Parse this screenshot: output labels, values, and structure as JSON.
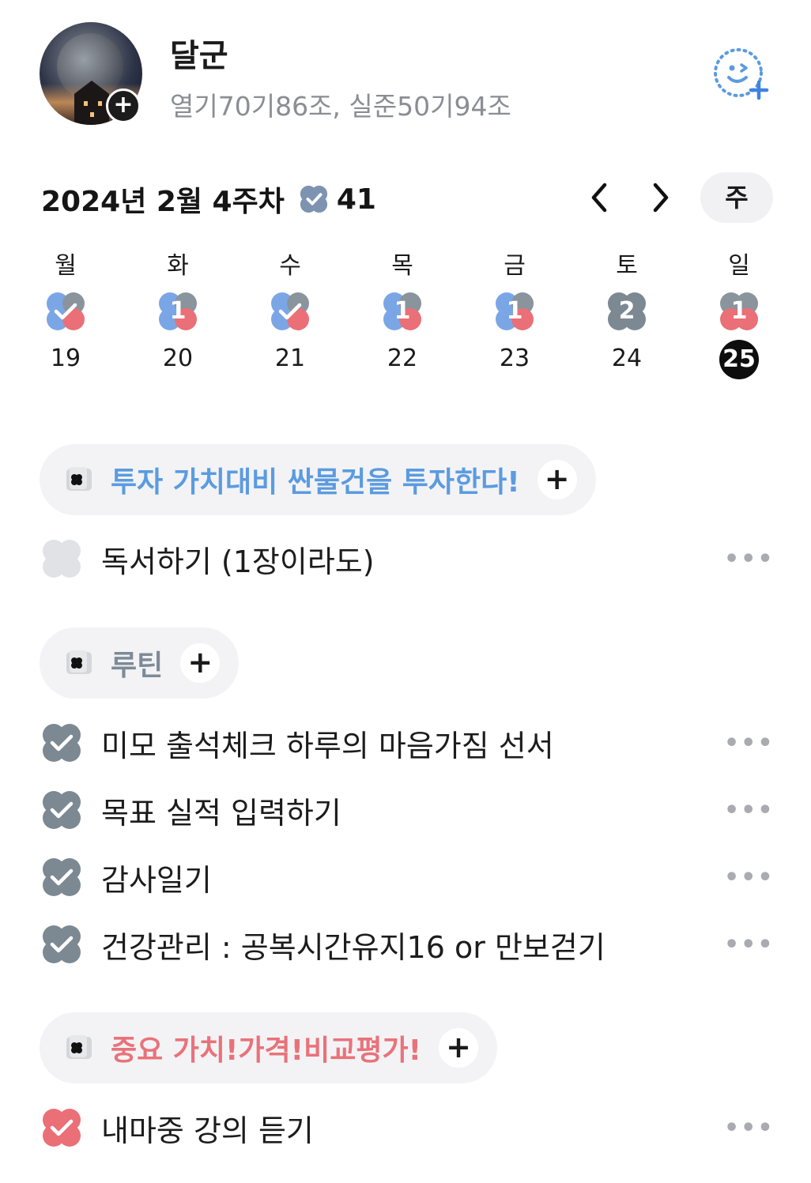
{
  "profile": {
    "name": "달군",
    "bio": "열기70기86조, 실준50기94조"
  },
  "week": {
    "title": "2024년 2월 4주차",
    "count": "41",
    "view_mode": "주",
    "days": [
      {
        "name": "월",
        "date": "19",
        "badge": "✓",
        "state": "done"
      },
      {
        "name": "화",
        "date": "20",
        "badge": "1",
        "state": "partial"
      },
      {
        "name": "수",
        "date": "21",
        "badge": "✓",
        "state": "done"
      },
      {
        "name": "목",
        "date": "22",
        "badge": "1",
        "state": "partial"
      },
      {
        "name": "금",
        "date": "23",
        "badge": "1",
        "state": "partial"
      },
      {
        "name": "토",
        "date": "24",
        "badge": "2",
        "state": "gray"
      },
      {
        "name": "일",
        "date": "25",
        "badge": "1",
        "state": "today"
      }
    ]
  },
  "categories": [
    {
      "label": "투자 가치대비 싼물건을 투자한다!",
      "color": "#5b9be0",
      "tasks": [
        {
          "text": "독서하기 (1장이라도)",
          "state": "empty"
        }
      ]
    },
    {
      "label": "루틴",
      "color": "#7d8b97",
      "tasks": [
        {
          "text": "미모 출석체크 하루의 마음가짐 선서",
          "state": "done"
        },
        {
          "text": "목표 실적 입력하기",
          "state": "done"
        },
        {
          "text": "감사일기",
          "state": "done"
        },
        {
          "text": "건강관리 : 공복시간유지16 or 만보걷기",
          "state": "done"
        }
      ]
    },
    {
      "label": "중요 가치!가격!비교평가!",
      "color": "#e9727a",
      "tasks": [
        {
          "text": "내마중 강의 듣기",
          "state": "done"
        }
      ]
    }
  ],
  "icons": {
    "more": "more-dots-icon",
    "prev": "chevron-left-icon",
    "next": "chevron-right-icon",
    "friend_add": "smiley-plus-icon",
    "week_badge": "clover-check-icon"
  }
}
